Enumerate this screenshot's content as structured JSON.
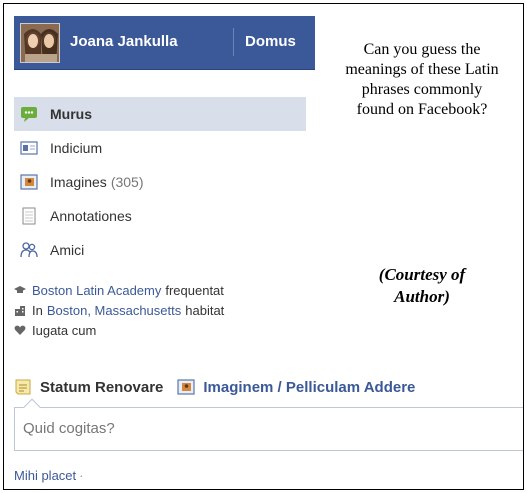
{
  "header": {
    "user_name": "Joana Jankulla",
    "home_link": "Domus"
  },
  "sidebar": {
    "items": [
      {
        "label": "Murus",
        "icon": "wall-icon",
        "active": true
      },
      {
        "label": "Indicium",
        "icon": "info-card-icon",
        "active": false
      },
      {
        "label": "Imagines",
        "count": "(305)",
        "icon": "photos-icon",
        "active": false
      },
      {
        "label": "Annotationes",
        "icon": "notes-icon",
        "active": false
      },
      {
        "label": "Amici",
        "icon": "friends-icon",
        "active": false
      }
    ]
  },
  "profile_info": {
    "school_link": "Boston Latin Academy",
    "school_suffix": "frequentat",
    "city_prefix": "In",
    "city_link": "Boston, Massachusetts",
    "city_suffix": "habitat",
    "relationship": "Iugata cum"
  },
  "caption": {
    "question": "Can you guess the meanings of these Latin phrases commonly found on Facebook?",
    "credit_line1": "(Courtesy of",
    "credit_line2": "Author)"
  },
  "publisher": {
    "status_tab": "Statum Renovare",
    "photo_tab": "Imaginem / Pelliculam Addere",
    "placeholder": "Quid cogitas?"
  },
  "footer": {
    "likes": "Mihi placet",
    "separator": "·"
  },
  "colors": {
    "facebook_blue": "#3b5998",
    "active_nav_bg": "#d8dfea",
    "input_border": "#bdc7d8"
  }
}
